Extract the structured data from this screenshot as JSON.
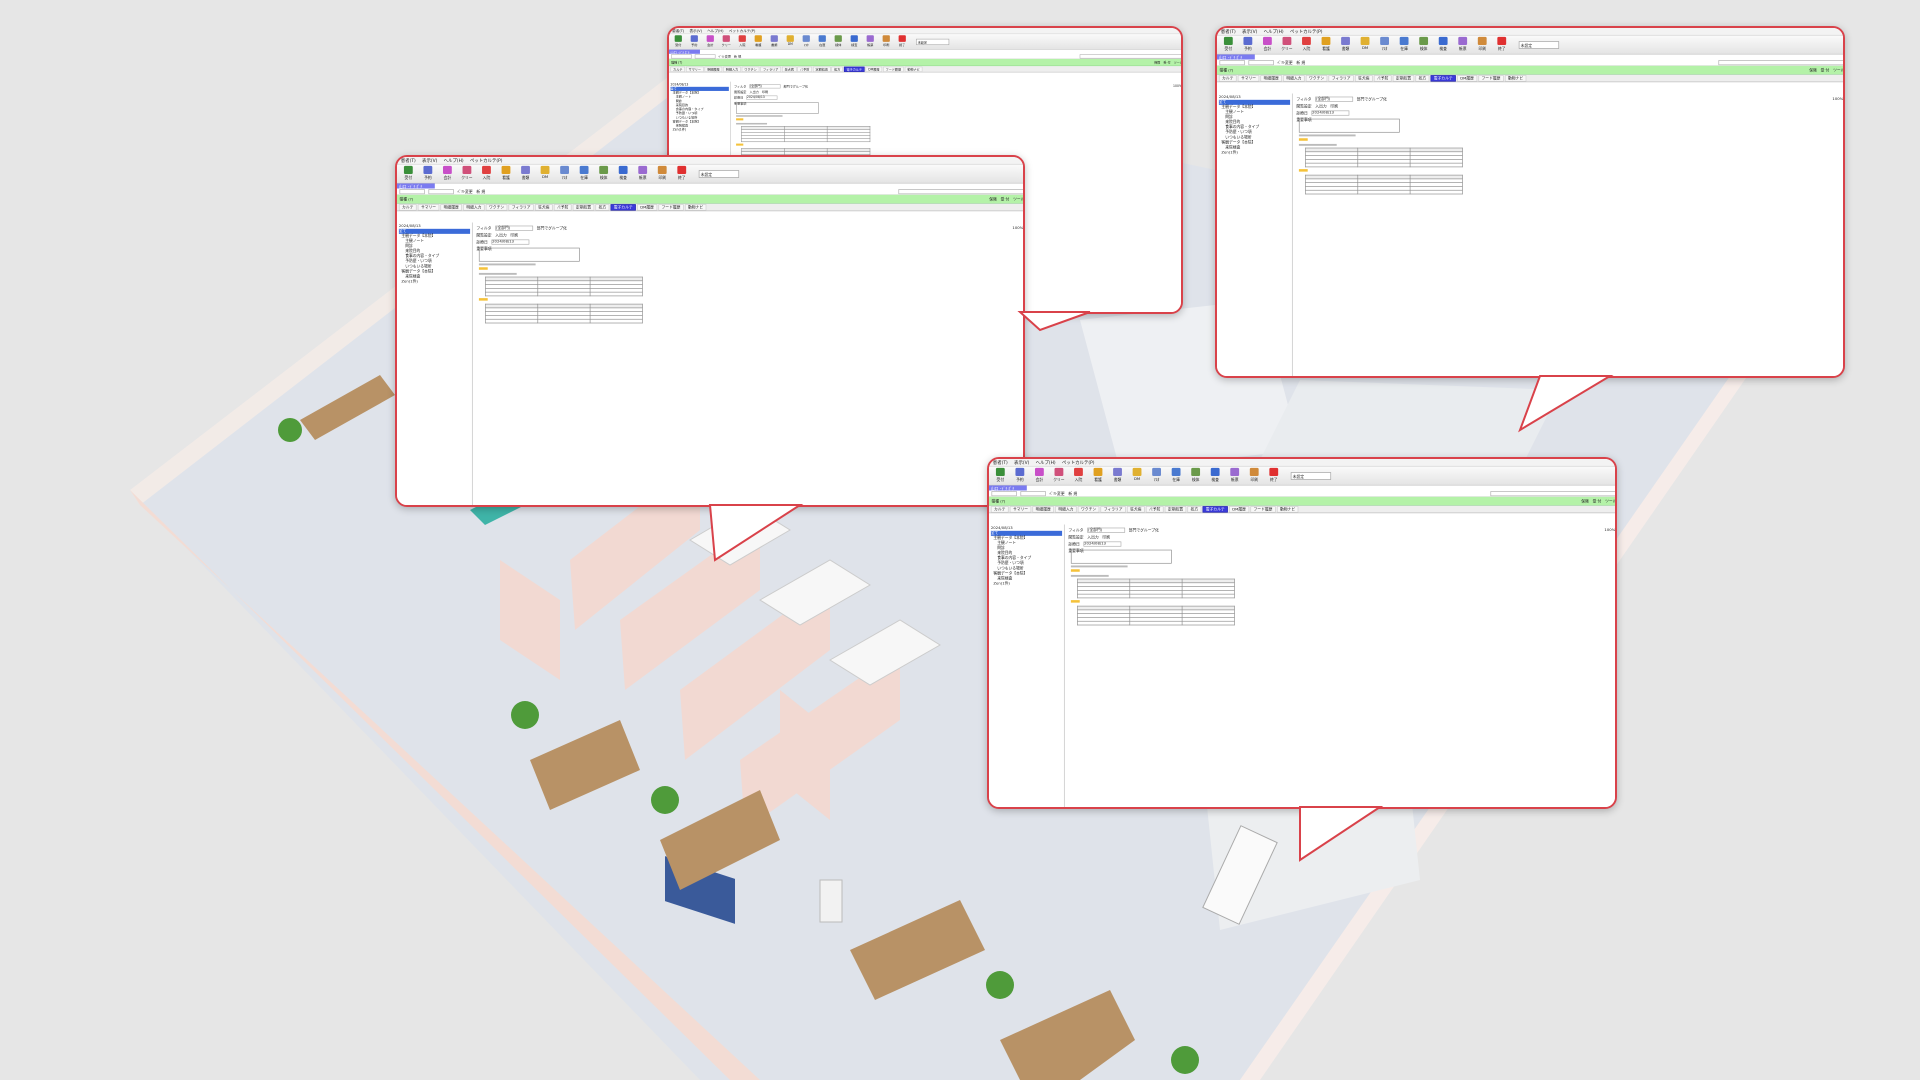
{
  "app": {
    "menu": [
      "患者(T)",
      "表示(V)",
      "ヘルプ(H)",
      "ペットカルテ(P)"
    ],
    "toolbar": [
      "受付",
      "予約",
      "会計",
      "クリー",
      "入院",
      "看護",
      "書類",
      "DM",
      "ﾏｽﾀ",
      "在庫",
      "検体",
      "検査",
      "帳票",
      "印刷",
      "終了"
    ],
    "toolbar_select": "未設定",
    "patient_strip": "山口 ･ﾃﾞﾁ ﾎﾟﾁ",
    "green_bar_label": "猫種 (?)",
    "row_buttons": [
      "ﾍﾟﾂﾄ変更",
      "新 規"
    ],
    "right_buttons": [
      "保険",
      "受 付",
      "ツール"
    ],
    "tabs": [
      "カルテ",
      "サマリー",
      "明細履歴",
      "明細入力",
      "ワクチン",
      "フィラリア",
      "狂犬病",
      "ﾉﾐ予防",
      "定期処置",
      "処方",
      "電子カルテ",
      "DM履歴",
      "フード履歴",
      "動物ナビ"
    ],
    "active_tab": "電子カルテ",
    "date": "2024/08/13",
    "tree": [
      "全て",
      "主観データ【本院】",
      "主観ノート",
      "問診",
      "来院目的",
      "食事の内容・タイプ",
      "予防歴・いつ頃",
      "いつもいる場所",
      "客観データ【本院】",
      "来院検査",
      "Zen(1件)"
    ],
    "filter_label": "フィルタ",
    "filter_value": "(全部門)",
    "group_label": "部門でグループ化",
    "view_label": "閲覧設定",
    "input_label": "入出力",
    "print_label": "印刷",
    "exam_date_label": "診療日",
    "exam_date": "2024/08/13",
    "important_label": "重要事項",
    "zoom": "100%"
  },
  "callouts": [
    {
      "name": "callout-top-center"
    },
    {
      "name": "callout-top-right"
    },
    {
      "name": "callout-mid-left"
    },
    {
      "name": "callout-bottom-right"
    }
  ]
}
